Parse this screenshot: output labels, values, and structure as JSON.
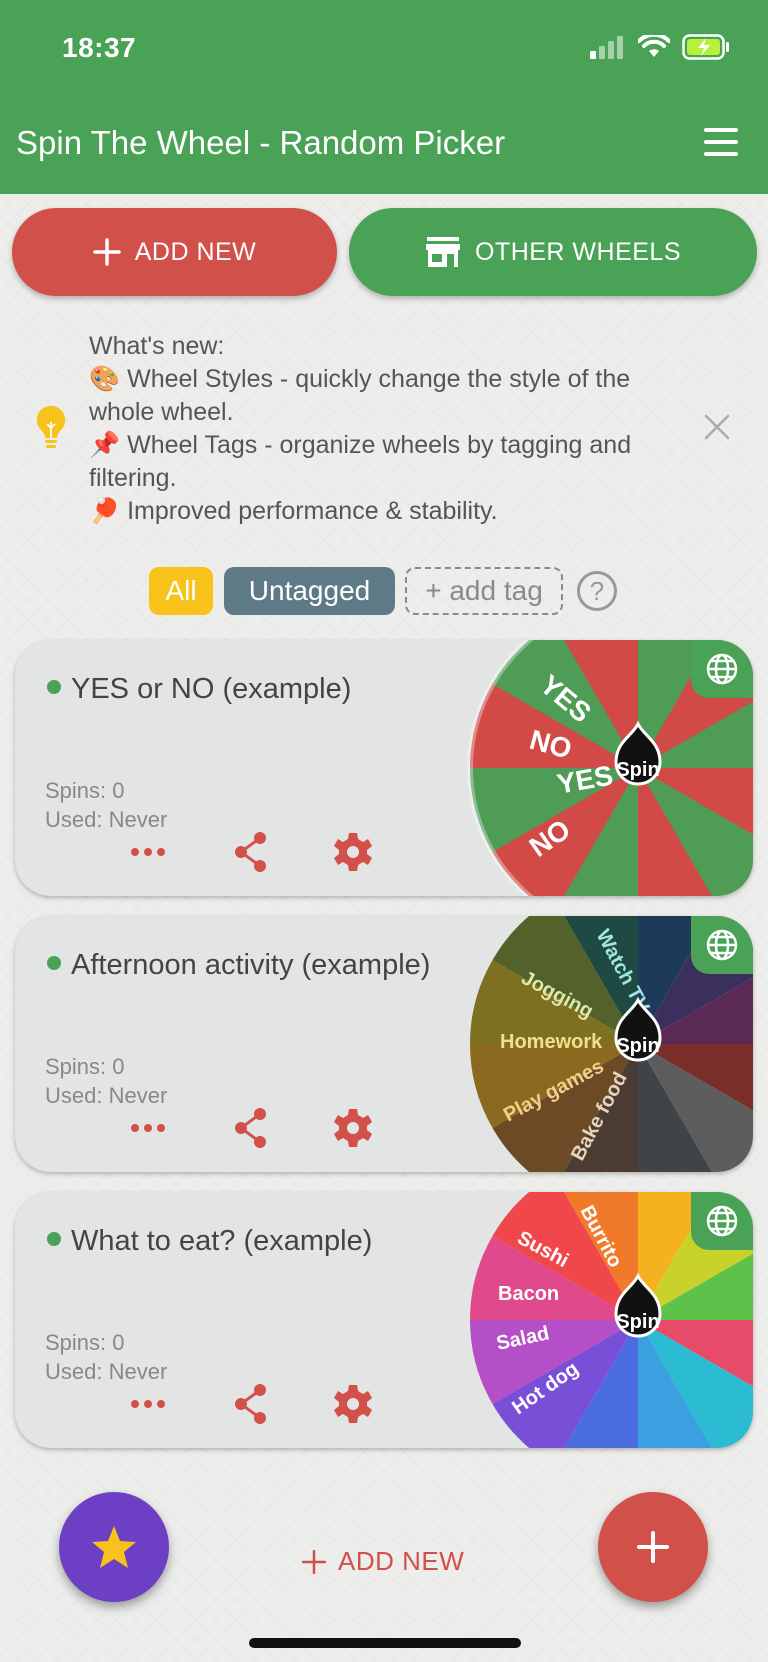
{
  "status_bar": {
    "time": "18:37"
  },
  "app_bar": {
    "title": "Spin The Wheel - Random Picker"
  },
  "top_buttons": {
    "add_new": "ADD NEW",
    "other_wheels": "OTHER WHEELS"
  },
  "whats_new": {
    "heading": "What's new:",
    "items": [
      {
        "emoji": "🎨",
        "text": "Wheel Styles - quickly change the style of the whole wheel."
      },
      {
        "emoji": "📌",
        "text": "Wheel Tags - organize wheels by tagging and filtering."
      },
      {
        "emoji": "🏓",
        "text": "Improved performance & stability."
      }
    ]
  },
  "tags": {
    "all": "All",
    "untagged": "Untagged",
    "add_tag": "+ add tag",
    "help": "?"
  },
  "wheels": [
    {
      "title": "YES or NO (example)",
      "spins": "Spins: 0",
      "used": "Used: Never",
      "spin_label": "Spin"
    },
    {
      "title": "Afternoon activity (example)",
      "spins": "Spins: 0",
      "used": "Used: Never",
      "spin_label": "Spin"
    },
    {
      "title": "What to eat? (example)",
      "spins": "Spins: 0",
      "used": "Used: Never",
      "spin_label": "Spin"
    }
  ],
  "bottom": {
    "add_new": "ADD NEW"
  },
  "colors": {
    "green": "#4aa257",
    "red": "#d2504a",
    "purple": "#6c3fc4",
    "yellow": "#f7c21a",
    "slate": "#5f7a87"
  }
}
